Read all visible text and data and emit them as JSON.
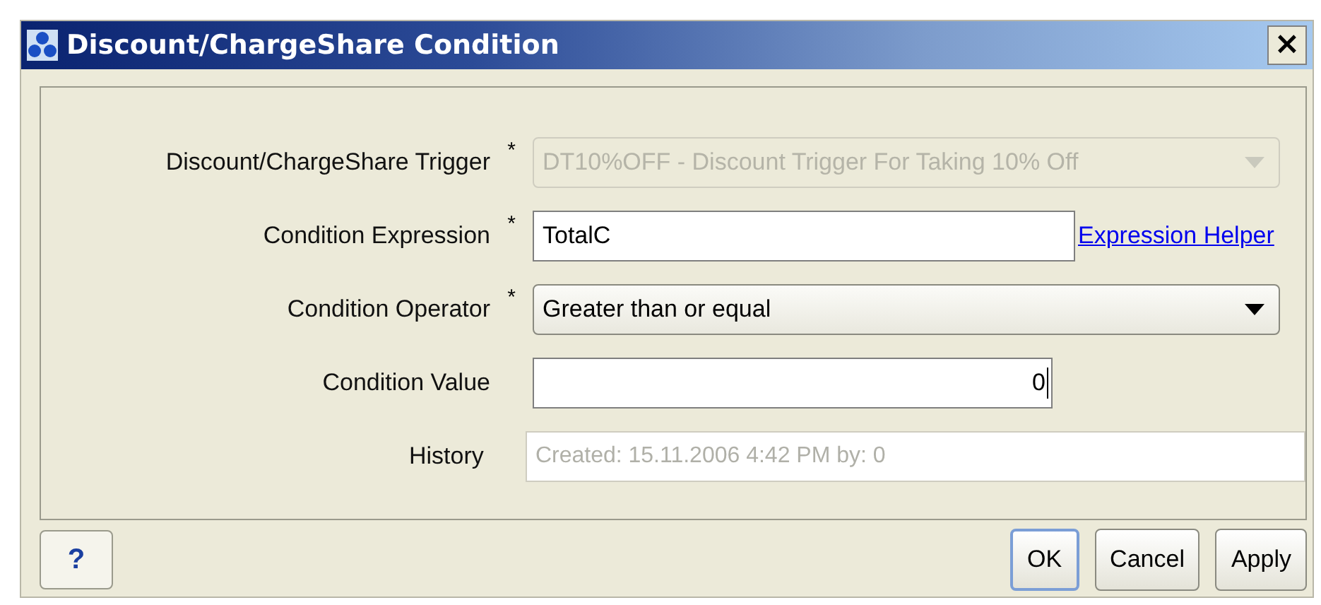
{
  "window": {
    "title": "Discount/ChargeShare Condition",
    "close": "×"
  },
  "fields": [
    {
      "kind": "select",
      "label": "Discount/ChargeShare Trigger",
      "required_mark": "*",
      "disabled": true,
      "value": "DT10%OFF - Discount Trigger For Taking 10% Off"
    },
    {
      "kind": "text",
      "label": "Condition Expression",
      "required_mark": "*",
      "value": "TotalC",
      "link": "Expression Helper"
    },
    {
      "kind": "select",
      "label": "Condition Operator",
      "required_mark": "*",
      "disabled": false,
      "value": "Greater than or equal"
    },
    {
      "kind": "number",
      "label": "Condition Value",
      "value": "0",
      "focused": true
    },
    {
      "kind": "readonly",
      "label": "History",
      "disabled": true,
      "value": "Created: 15.11.2006 4:42 PM by: 0"
    }
  ],
  "help_button": "?",
  "buttons": [
    {
      "label": "OK",
      "default": true
    },
    {
      "label": "Cancel",
      "default": false
    },
    {
      "label": "Apply",
      "default": false
    }
  ]
}
